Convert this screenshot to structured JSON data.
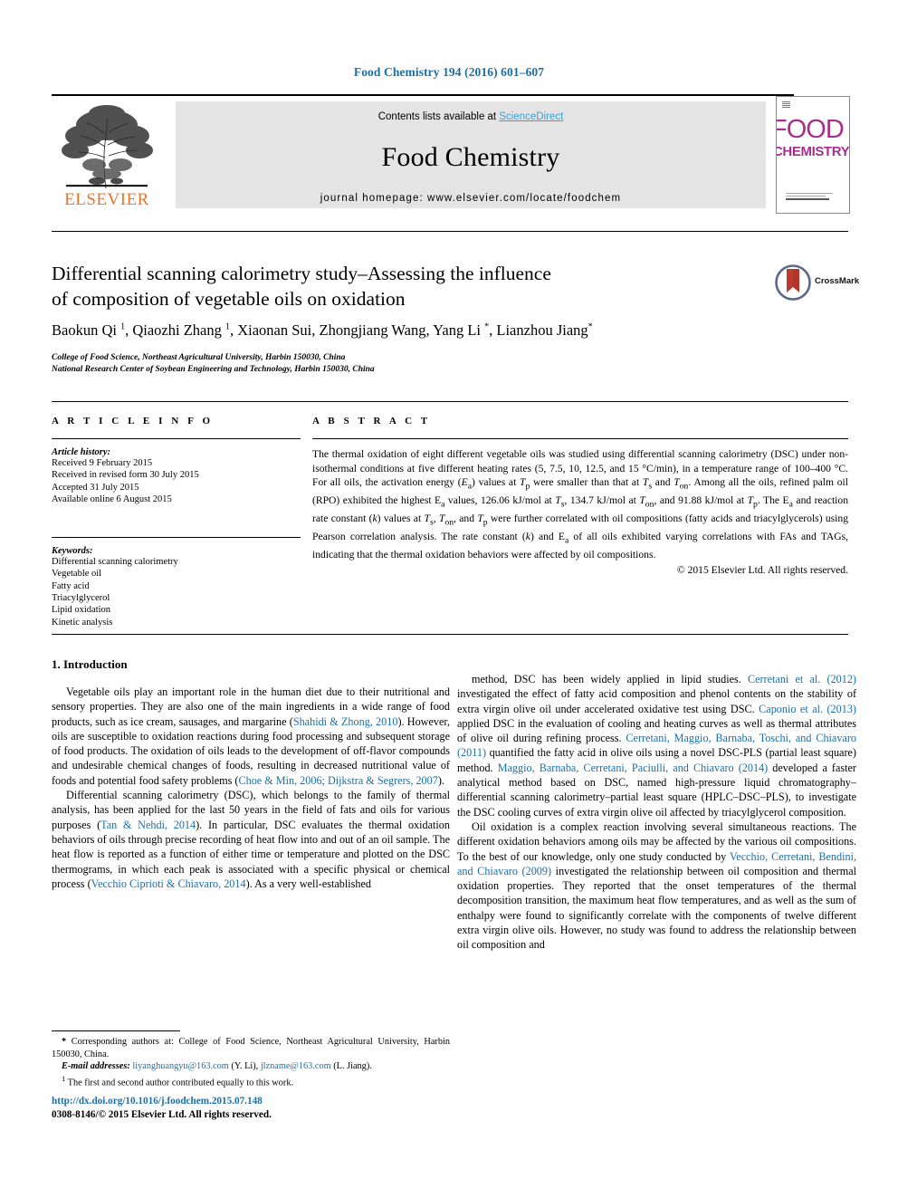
{
  "running_head": "Food Chemistry 194 (2016) 601–607",
  "masthead": {
    "contents_prefix": "Contents lists available at ",
    "sciencedirect": "ScienceDirect",
    "journal_name": "Food Chemistry",
    "homepage": "journal homepage: www.elsevier.com/locate/foodchem",
    "publisher": "ELSEVIER",
    "cover": {
      "line1": "FOOD",
      "line2": "CHEMISTRY"
    }
  },
  "article": {
    "title_line1": "Differential scanning calorimetry study–Assessing the influence",
    "title_line2": "of composition of vegetable oils on oxidation",
    "crossmark_label": "CrossMark",
    "authors_html": "Baokun Qi <sup>1</sup>, Qiaozhi Zhang <sup>1</sup>, Xiaonan Sui, Zhongjiang Wang, Yang Li <sup>*</sup>, Lianzhou Jiang<sup>*</sup>",
    "affiliation_1": "College of Food Science, Northeast Agricultural University, Harbin 150030, China",
    "affiliation_2": "National Research Center of Soybean Engineering and Technology, Harbin 150030, China"
  },
  "article_info": {
    "heading": "A R T I C L E  I N F O",
    "history_label": "Article history:",
    "history": [
      "Received 9 February 2015",
      "Received in revised form 30 July 2015",
      "Accepted 31 July 2015",
      "Available online 6 August 2015"
    ],
    "keywords_label": "Keywords:",
    "keywords": [
      "Differential scanning calorimetry",
      "Vegetable oil",
      "Fatty acid",
      "Triacylglycerol",
      "Lipid oxidation",
      "Kinetic analysis"
    ]
  },
  "abstract": {
    "heading": "A B S T R A C T",
    "body_html": "The thermal oxidation of eight different vegetable oils was studied using differential scanning calorimetry (DSC) under non-isothermal conditions at five different heating rates (5, 7.5, 10, 12.5, and 15 &#176;C/min), in a temperature range of 100–400 &#176;C. For all oils, the activation energy (<i>E</i><sub>a</sub>) values at <i>T</i><sub>p</sub> were smaller than that at <i>T</i><sub>s</sub> and <i>T</i><sub>on</sub>. Among all the oils, refined palm oil (RPO) exhibited the highest E<sub>a</sub> values, 126.06 kJ/mol at <i>T</i><sub>s</sub>, 134.7 kJ/mol at <i>T</i><sub>on</sub>, and 91.88 kJ/mol at <i>T</i><sub>p</sub>. The E<sub>a</sub> and reaction rate constant (<i>k</i>) values at <i>T</i><sub>s</sub>, <i>T</i><sub>on</sub>, and <i>T</i><sub>p</sub> were further correlated with oil compositions (fatty acids and triacylglycerols) using Pearson correlation analysis. The rate constant (<i>k</i>) and E<sub>a</sub> of all oils exhibited varying correlations with FAs and TAGs, indicating that the thermal oxidation behaviors were affected by oil compositions.",
    "copyright": "© 2015 Elsevier Ltd. All rights reserved."
  },
  "introduction": {
    "heading": "1. Introduction",
    "left_paragraphs_html": [
      "Vegetable oils play an important role in the human diet due to their nutritional and sensory properties. They are also one of the main ingredients in a wide range of food products, such as ice cream, sausages, and margarine (<span class=\"cite\">Shahidi &amp; Zhong, 2010</span>). However, oils are susceptible to oxidation reactions during food processing and subsequent storage of food products. The oxidation of oils leads to the development of off-flavor compounds and undesirable chemical changes of foods, resulting in decreased nutritional value of foods and potential food safety problems (<span class=\"cite\">Choe &amp; Min, 2006; Dijkstra &amp; Segrers, 2007</span>).",
      "Differential scanning calorimetry (DSC), which belongs to the family of thermal analysis, has been applied for the last 50 years in the field of fats and oils for various purposes (<span class=\"cite\">Tan &amp; Nehdi, 2014</span>). In particular, DSC evaluates the thermal oxidation behaviors of oils through precise recording of heat flow into and out of an oil sample. The heat flow is reported as a function of either time or temperature and plotted on the DSC thermograms, in which each peak is associated with a specific physical or chemical process (<span class=\"cite\">Vecchio Ciprioti &amp; Chiavaro, 2014</span>). As a very well-established"
    ],
    "right_paragraphs_html": [
      "method, DSC has been widely applied in lipid studies. <span class=\"cite\">Cerretani et al. (2012)</span> investigated the effect of fatty acid composition and phenol contents on the stability of extra virgin olive oil under accelerated oxidative test using DSC. <span class=\"cite\">Caponio et al. (2013)</span> applied DSC in the evaluation of cooling and heating curves as well as thermal attributes of olive oil during refining process. <span class=\"cite\">Cerretani, Maggio, Barnaba, Toschi, and Chiavaro (2011)</span> quantified the fatty acid in olive oils using a novel DSC-PLS (partial least square) method. <span class=\"cite\">Maggio, Barnaba, Cerretani, Paciulli, and Chiavaro (2014)</span> developed a faster analytical method based on DSC, named high-pressure liquid chromatography–differential scanning calorimetry–partial least square (HPLC–DSC–PLS), to investigate the DSC cooling curves of extra virgin olive oil affected by triacylglycerol composition.",
      "Oil oxidation is a complex reaction involving several simultaneous reactions. The different oxidation behaviors among oils may be affected by the various oil compositions. To the best of our knowledge, only one study conducted by <span class=\"cite\">Vecchio, Cerretani, Bendini, and Chiavaro (2009)</span> investigated the relationship between oil composition and thermal oxidation properties. They reported that the onset temperatures of the thermal decomposition transition, the maximum heat flow temperatures, and as well as the sum of enthalpy were found to significantly correlate with the components of twelve different extra virgin olive oils. However, no study was found to address the relationship between oil composition and"
    ]
  },
  "footnotes": {
    "corresponding_html": "<b>*</b> Corresponding authors at: College of Food Science, Northeast Agricultural University, Harbin 150030, China.",
    "email_html": "<span class=\"fn-italic\">E-mail addresses:</span> <span class=\"fn-link\">liyanghuangyu@163.com</span> (Y. Li), <span class=\"fn-link\">jlzname@163.com</span> (L. Jiang).",
    "equal_contrib_html": "<sup>1</sup> The first and second author contributed equally to this work."
  },
  "footer": {
    "doi": "http://dx.doi.org/10.1016/j.foodchem.2015.07.148",
    "issn": "0308-8146/© 2015 Elsevier Ltd. All rights reserved."
  },
  "colors": {
    "link_blue": "#1a6fa8",
    "sciencedirect_blue": "#3a9fd6",
    "elsevier_orange": "#e8742a",
    "cover_magenta": "#a5308e",
    "crossmark_red": "#b5342a"
  }
}
